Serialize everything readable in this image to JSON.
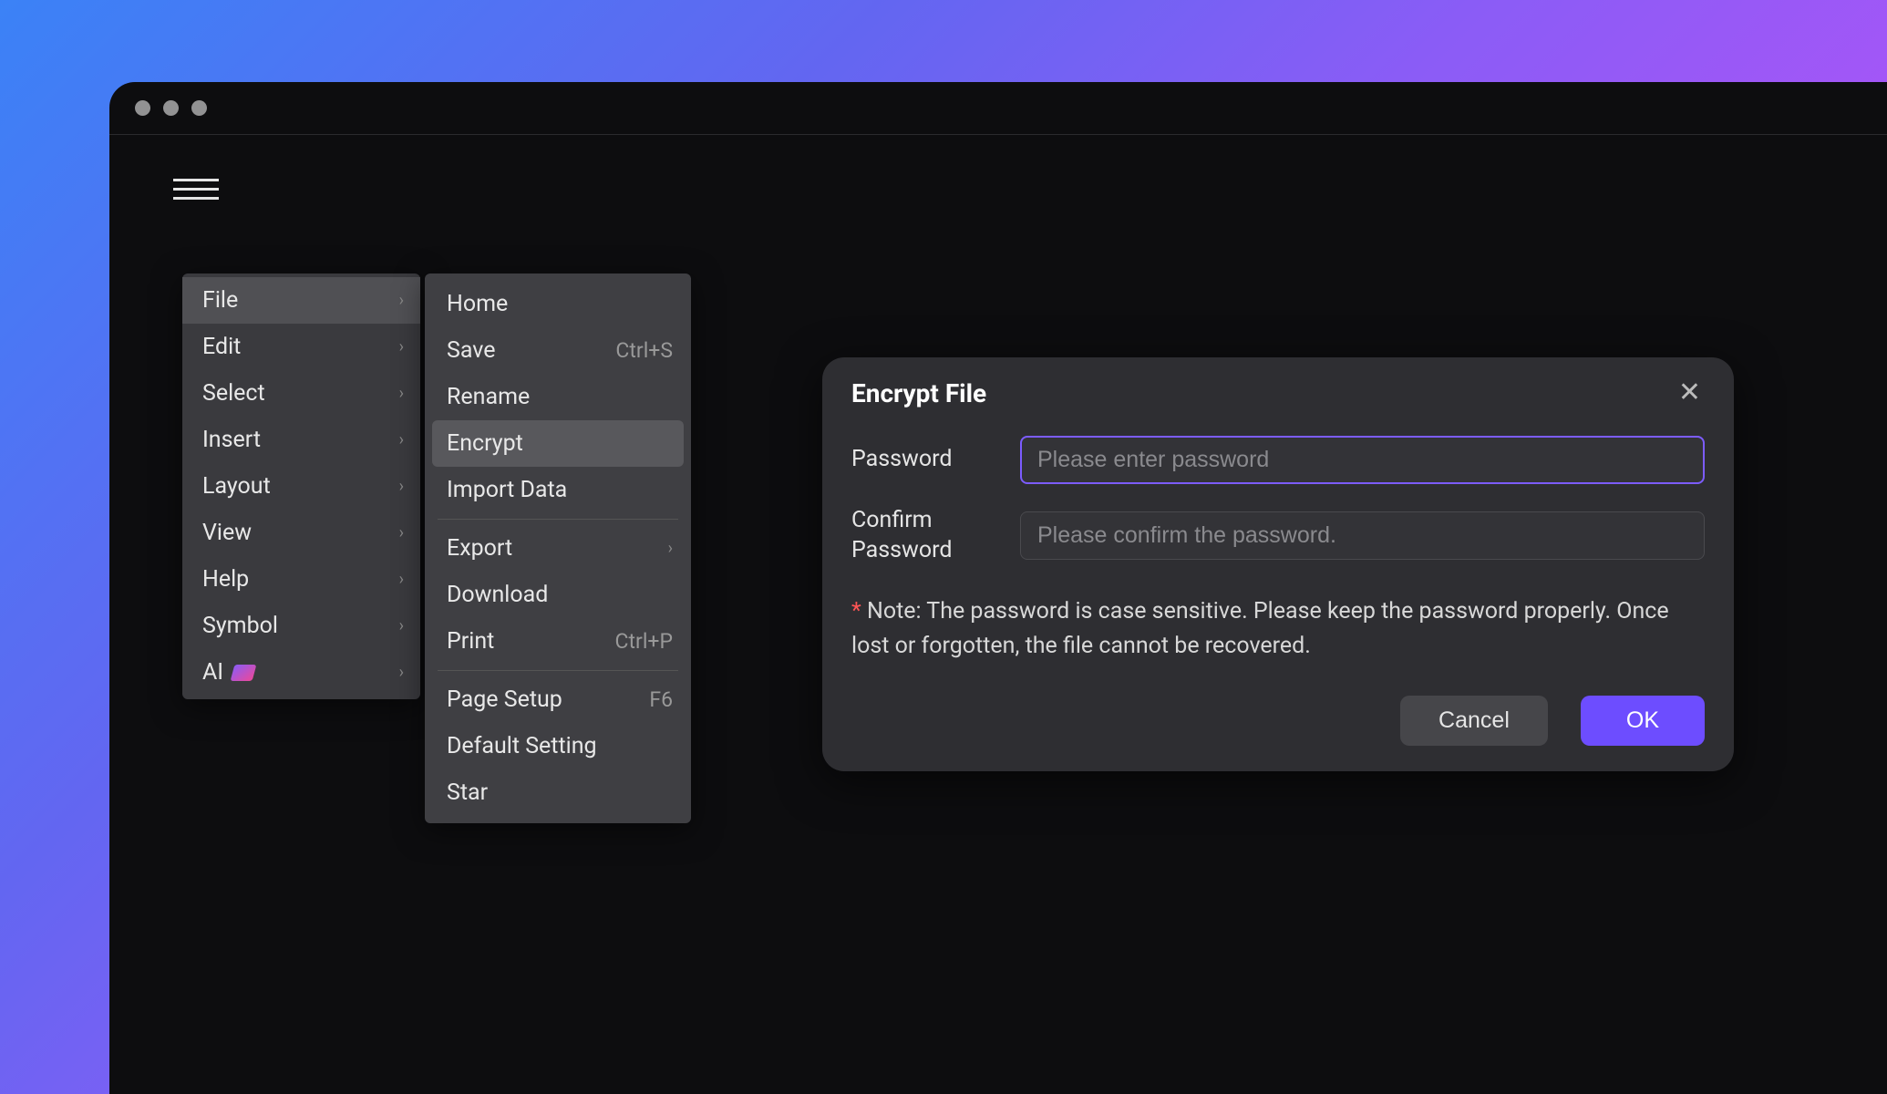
{
  "main_menu": {
    "items": [
      {
        "label": "File",
        "has_submenu": true,
        "active": true
      },
      {
        "label": "Edit",
        "has_submenu": true
      },
      {
        "label": "Select",
        "has_submenu": true
      },
      {
        "label": "Insert",
        "has_submenu": true
      },
      {
        "label": "Layout",
        "has_submenu": true
      },
      {
        "label": "View",
        "has_submenu": true
      },
      {
        "label": "Help",
        "has_submenu": true
      },
      {
        "label": "Symbol",
        "has_submenu": true
      },
      {
        "label": "AI",
        "has_submenu": true,
        "badge": true
      }
    ]
  },
  "submenu": {
    "items": [
      {
        "label": "Home"
      },
      {
        "label": "Save",
        "shortcut": "Ctrl+S"
      },
      {
        "label": "Rename"
      },
      {
        "label": "Encrypt",
        "highlighted": true
      },
      {
        "label": "Import Data"
      },
      {
        "divider": true
      },
      {
        "label": "Export",
        "has_submenu": true
      },
      {
        "label": "Download"
      },
      {
        "label": "Print",
        "shortcut": "Ctrl+P"
      },
      {
        "divider": true
      },
      {
        "label": "Page Setup",
        "shortcut": "F6"
      },
      {
        "label": "Default Setting"
      },
      {
        "label": "Star"
      }
    ]
  },
  "dialog": {
    "title": "Encrypt File",
    "password_label": "Password",
    "password_placeholder": "Please enter password",
    "confirm_label": "Confirm Password",
    "confirm_placeholder": "Please confirm the password.",
    "note_star": "*",
    "note_text": " Note: The password is case sensitive. Please keep the password properly. Once lost or forgotten, the file cannot be recovered.",
    "cancel_label": "Cancel",
    "ok_label": "OK"
  }
}
